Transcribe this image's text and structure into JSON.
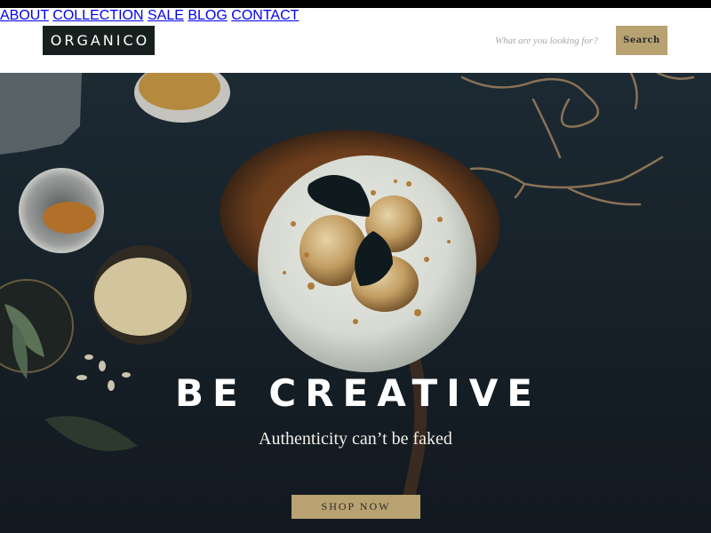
{
  "header": {
    "logo": "ORGANICO",
    "nav": [
      {
        "label": "ABOUT"
      },
      {
        "label": "COLLECTION"
      },
      {
        "label": "SALE"
      },
      {
        "label": "BLOG"
      },
      {
        "label": "CONTACT"
      }
    ],
    "search": {
      "placeholder": "What are you looking for?",
      "value": "",
      "button_label": "Search"
    }
  },
  "hero": {
    "title": "BE CREATIVE",
    "subtitle": "Authenticity can’t be faked",
    "cta_label": "SHOP NOW",
    "image_description": "Top-down photo of a frosted cake with poached pears and dark leaves on a wooden board, surrounded by bowls of nuts and spices on a dark table"
  },
  "colors": {
    "accent": "#b8a272",
    "logo_bg": "#18201f",
    "hero_bg": "#18232b",
    "header_bg": "#ffffff"
  }
}
